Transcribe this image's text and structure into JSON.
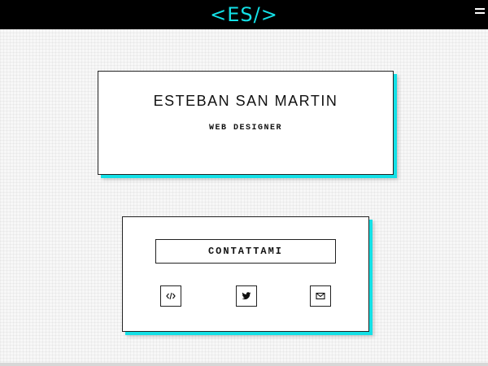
{
  "header": {
    "logo_text": "<ES/>",
    "menu_icon": "hamburger-menu-icon",
    "background_color": "#000000",
    "accent_color": "#13e0e6"
  },
  "profile_card": {
    "name": "ESTEBAN SAN MARTIN",
    "role": "WEB DESIGNER"
  },
  "contact_card": {
    "contact_button_label": "CONTATTAMI",
    "social_links": [
      {
        "icon": "code-icon"
      },
      {
        "icon": "twitter-icon"
      },
      {
        "icon": "mail-icon"
      }
    ]
  }
}
